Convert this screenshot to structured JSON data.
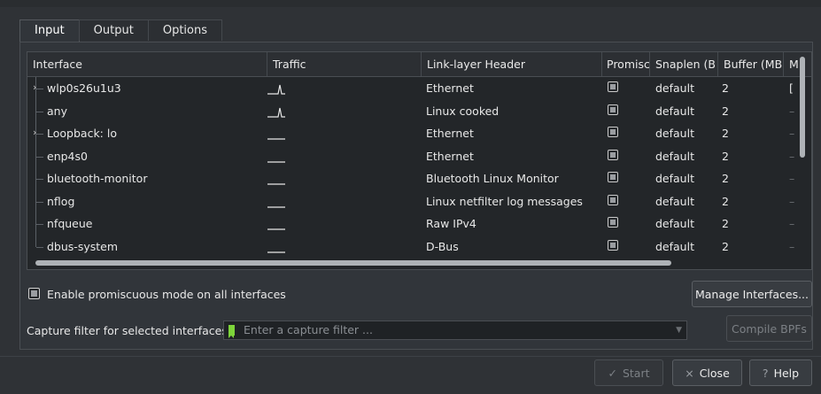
{
  "tabs": [
    "Input",
    "Output",
    "Options"
  ],
  "table": {
    "headers": [
      "Interface",
      "Traffic",
      "Link-layer Header",
      "Promisc",
      "Snaplen (B",
      "Buffer (MB",
      "M"
    ],
    "rows": [
      {
        "name": "wlp0s26u1u3",
        "expand": "›",
        "traffic": "spike",
        "link": "Ethernet",
        "snaplen": "default",
        "buffer": "2",
        "m": "["
      },
      {
        "name": "any",
        "expand": "",
        "traffic": "spike",
        "link": "Linux cooked",
        "snaplen": "default",
        "buffer": "2",
        "m": "–"
      },
      {
        "name": "Loopback: lo",
        "expand": "›",
        "traffic": "flat",
        "link": "Ethernet",
        "snaplen": "default",
        "buffer": "2",
        "m": "–"
      },
      {
        "name": "enp4s0",
        "expand": "",
        "traffic": "flat",
        "link": "Ethernet",
        "snaplen": "default",
        "buffer": "2",
        "m": "–"
      },
      {
        "name": "bluetooth-monitor",
        "expand": "",
        "traffic": "flat",
        "link": "Bluetooth Linux Monitor",
        "snaplen": "default",
        "buffer": "2",
        "m": "–"
      },
      {
        "name": "nflog",
        "expand": "",
        "traffic": "flat",
        "link": "Linux netfilter log messages",
        "snaplen": "default",
        "buffer": "2",
        "m": "–"
      },
      {
        "name": "nfqueue",
        "expand": "",
        "traffic": "flat",
        "link": "Raw IPv4",
        "snaplen": "default",
        "buffer": "2",
        "m": "–"
      },
      {
        "name": "dbus-system",
        "expand": "",
        "traffic": "flat",
        "link": "D-Bus",
        "snaplen": "default",
        "buffer": "2",
        "m": "–"
      }
    ]
  },
  "promisc_all_label": "Enable promiscuous mode on all interfaces",
  "manage_label": "Manage Interfaces...",
  "filter": {
    "label": "Capture filter for selected interfaces:",
    "placeholder": "Enter a capture filter ...",
    "dropdown_icon": "chevron-down-icon",
    "bookmark_color": "#7dd43a"
  },
  "compile_label": "Compile BPFs",
  "footer": {
    "start_label": "Start",
    "start_icon": "check-icon",
    "close_label": "Close",
    "close_icon": "close-icon",
    "help_label": "Help",
    "help_icon": "help-icon"
  }
}
